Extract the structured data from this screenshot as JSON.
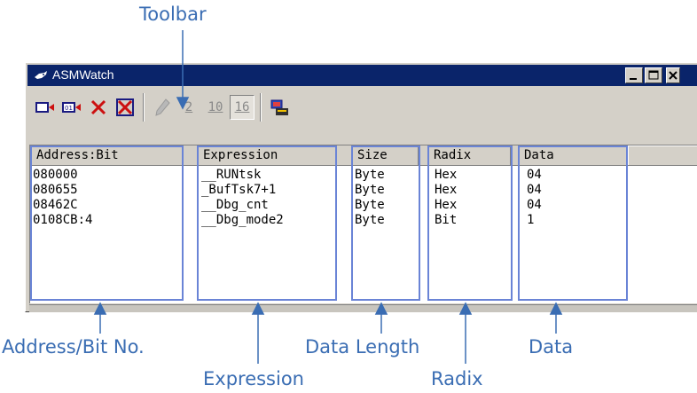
{
  "callouts": {
    "toolbar": "Toolbar",
    "address": "Address/Bit No.",
    "expression": "Expression",
    "data_length": "Data Length",
    "radix": "Radix",
    "data": "Data"
  },
  "window": {
    "title": "ASMWatch"
  },
  "toolbar": {
    "radix_2": "2",
    "radix_10": "10",
    "radix_16": "16",
    "active_radix": "16"
  },
  "columns": [
    "Address:Bit",
    "Expression",
    "Size",
    "Radix",
    "Data"
  ],
  "rows": [
    [
      "080000",
      "__RUNtsk",
      "Byte",
      "Hex",
      "04"
    ],
    [
      "080655",
      "_BufTsk7+1",
      "Byte",
      "Hex",
      "04"
    ],
    [
      "08462C",
      "__Dbg_cnt",
      "Byte",
      "Hex",
      "04"
    ],
    [
      "0108CB:4",
      "__Dbg_mode2",
      "Byte",
      "Bit",
      "1"
    ]
  ],
  "colors": {
    "callout": "#3a6db3",
    "titlebar": "#0a246a",
    "highlight": "#6a84d6"
  }
}
